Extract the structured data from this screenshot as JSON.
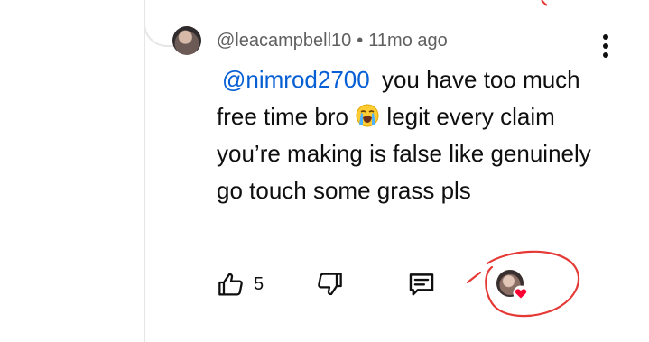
{
  "comment": {
    "username": "@leacampbell10",
    "separator": "•",
    "time_ago": "11mo ago",
    "mention": "@nimrod2700",
    "text_part1": "you have too much free time bro",
    "text_part2": " legit every claim you’re making is false like genuinely go touch some grass pls",
    "emoji": "loudly-crying-face"
  },
  "actions": {
    "like_count": "5",
    "like_icon": "thumbs-up-icon",
    "dislike_icon": "thumbs-down-icon",
    "reply_icon": "comment-icon"
  },
  "colors": {
    "text": "#0f0f0f",
    "secondary": "#606060",
    "mention": "#065fd4",
    "annotation_red": "#e53935",
    "heart_red": "#ff0033"
  }
}
